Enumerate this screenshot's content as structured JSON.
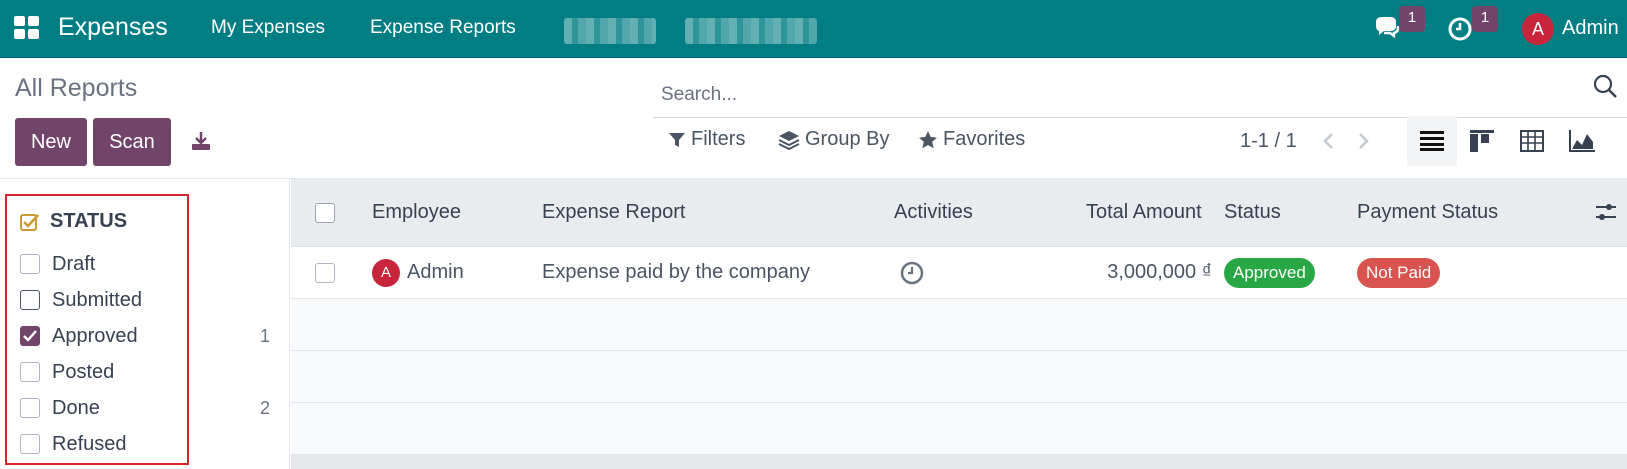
{
  "navbar": {
    "app_name": "Expenses",
    "menu": [
      "My Expenses",
      "Expense Reports"
    ],
    "messages_count": "1",
    "activities_count": "1",
    "user_initial": "A",
    "user_name": "Admin",
    "bg_color": "#017e84"
  },
  "control_panel": {
    "title": "All Reports",
    "new_label": "New",
    "scan_label": "Scan",
    "search_placeholder": "Search...",
    "filters_label": "Filters",
    "group_by_label": "Group By",
    "favorites_label": "Favorites",
    "pager": "1-1 / 1",
    "views": [
      "list-view-icon",
      "kanban-view-icon",
      "pivot-view-icon",
      "graph-view-icon"
    ],
    "accent_color": "#71456a"
  },
  "sidebar": {
    "header": "STATUS",
    "items": [
      {
        "label": "Draft",
        "checked": false,
        "count": ""
      },
      {
        "label": "Submitted",
        "checked": false,
        "count": ""
      },
      {
        "label": "Approved",
        "checked": true,
        "count": "1"
      },
      {
        "label": "Posted",
        "checked": false,
        "count": ""
      },
      {
        "label": "Done",
        "checked": false,
        "count": "2"
      },
      {
        "label": "Refused",
        "checked": false,
        "count": ""
      }
    ]
  },
  "table": {
    "columns": [
      "Employee",
      "Expense Report",
      "Activities",
      "Total Amount",
      "Status",
      "Payment Status"
    ],
    "rows": [
      {
        "employee_initial": "A",
        "employee": "Admin",
        "expense_report": "Expense paid by the company",
        "activity_icon": "clock-icon",
        "total_amount": "3,000,000 ₫",
        "status": "Approved",
        "status_color": "#28a745",
        "payment_status": "Not Paid",
        "payment_status_color": "#d9534f"
      }
    ]
  }
}
